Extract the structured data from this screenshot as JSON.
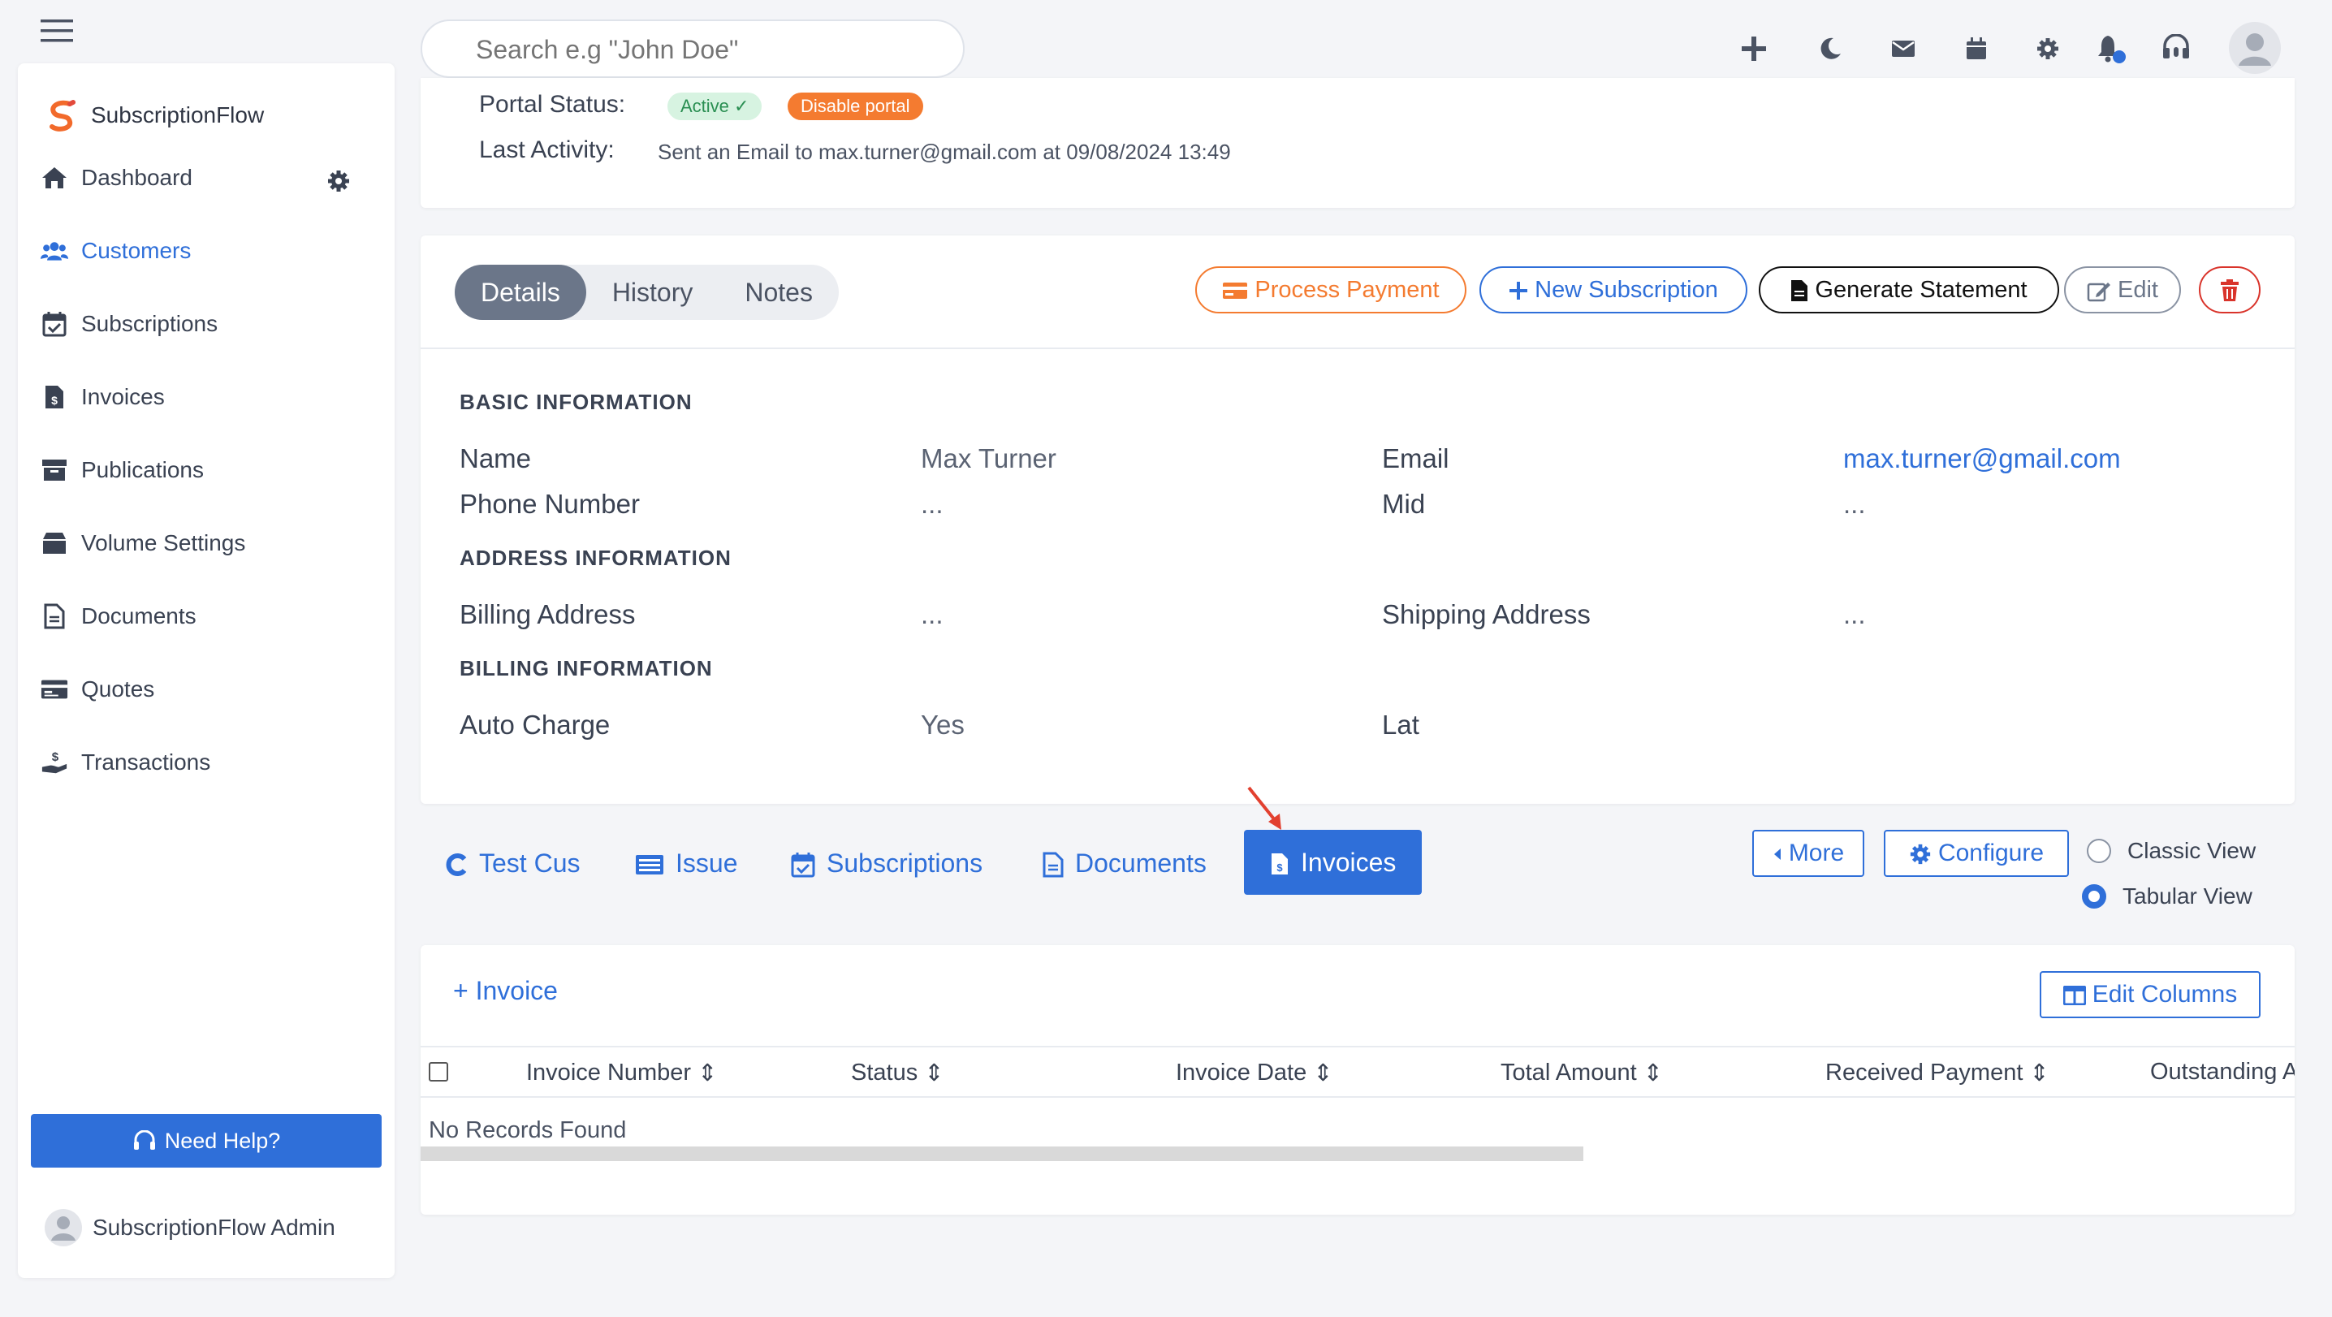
{
  "search": {
    "placeholder": "Search e.g \"John Doe\""
  },
  "sidebar": {
    "brand": "SubscriptionFlow",
    "items": [
      {
        "label": "Dashboard",
        "icon": "home-icon"
      },
      {
        "label": "Customers",
        "icon": "users-icon"
      },
      {
        "label": "Subscriptions",
        "icon": "calendar-check-icon"
      },
      {
        "label": "Invoices",
        "icon": "invoice-icon"
      },
      {
        "label": "Publications",
        "icon": "archive-icon"
      },
      {
        "label": "Volume Settings",
        "icon": "box-icon"
      },
      {
        "label": "Documents",
        "icon": "document-icon"
      },
      {
        "label": "Quotes",
        "icon": "quote-card-icon"
      },
      {
        "label": "Transactions",
        "icon": "hand-dollar-icon"
      }
    ],
    "help_label": "Need Help?",
    "admin_name": "SubscriptionFlow Admin"
  },
  "header_card": {
    "portal_status_label": "Portal Status:",
    "status_badge": "Active ✓",
    "disable_portal": "Disable portal",
    "last_activity_label": "Last Activity:",
    "last_activity_text": "Sent an Email to max.turner@gmail.com at 09/08/2024 13:49"
  },
  "detail": {
    "tabs": [
      "Details",
      "History",
      "Notes"
    ],
    "actions": {
      "process_payment": "Process Payment",
      "new_subscription": "New Subscription",
      "generate_statement": "Generate Statement",
      "edit": "Edit"
    },
    "sections": {
      "basic": "BASIC INFORMATION",
      "address": "ADDRESS INFORMATION",
      "billing": "BILLING INFORMATION"
    },
    "fields": {
      "name_label": "Name",
      "name_value": "Max Turner",
      "email_label": "Email",
      "email_value": "max.turner@gmail.com",
      "phone_label": "Phone Number",
      "phone_value": "...",
      "mid_label": "Mid",
      "mid_value": "...",
      "billing_address_label": "Billing Address",
      "billing_address_value": "...",
      "shipping_address_label": "Shipping Address",
      "shipping_address_value": "...",
      "auto_charge_label": "Auto Charge",
      "auto_charge_value": "Yes",
      "lat_label": "Lat"
    }
  },
  "related": {
    "tabs": [
      "Test Cus",
      "Issue",
      "Subscriptions",
      "Documents",
      "Invoices"
    ],
    "more": "More",
    "configure": "Configure",
    "views": [
      "Classic View",
      "Tabular View"
    ],
    "selected_view": "Tabular View"
  },
  "invoices_table": {
    "add_label": "+ Invoice",
    "edit_columns": "Edit Columns",
    "columns": [
      "Invoice Number",
      "Status",
      "Invoice Date",
      "Total Amount",
      "Received Payment",
      "Outstanding A"
    ],
    "empty_text": "No Records Found"
  },
  "colors": {
    "accent": "#2f6fd9",
    "orange": "#f47b30",
    "danger": "#d9342b"
  }
}
